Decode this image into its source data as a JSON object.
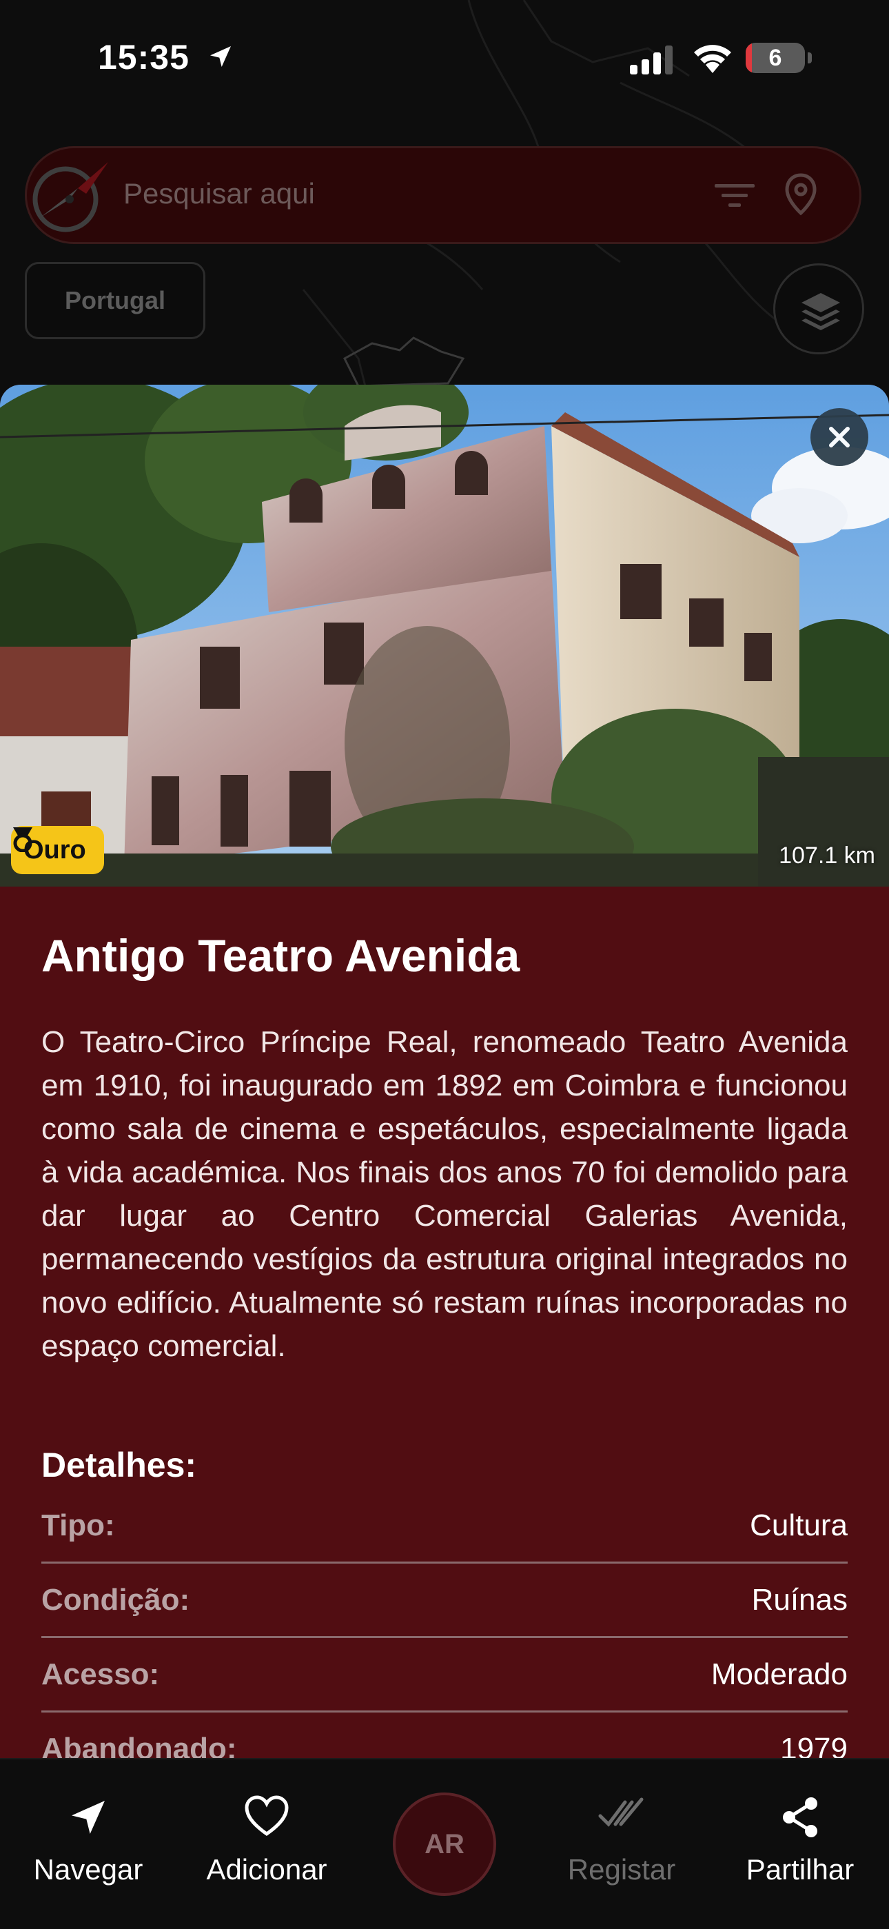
{
  "status_bar": {
    "time": "15:35",
    "battery_level": "6",
    "location_icon": "location-arrow-icon",
    "signal_icon": "cellular-signal-icon",
    "wifi_icon": "wifi-icon"
  },
  "search": {
    "placeholder": "Pesquisar aqui",
    "filter_icon": "filter-icon",
    "location_icon": "map-pin-icon"
  },
  "map": {
    "region_chip": "Portugal",
    "layers_icon": "layers-icon"
  },
  "place": {
    "tier": "Ouro",
    "tier_color": "#f5c518",
    "distance": "107.1 km",
    "title": "Antigo Teatro Avenida",
    "description": "O Teatro-Circo Príncipe Real, renomeado Teatro Avenida em 1910, foi inaugurado em 1892 em Coimbra e funcionou como sala de cinema e espetáculos, especialmente ligada à vida académica. Nos finais dos anos 70 foi demolido para dar lugar ao Centro Comercial Galerias Avenida, permanecendo vestígios da estrutura original integrados no novo edifício. Atualmente só restam ruínas incorporadas no espaço comercial.",
    "details_heading": "Detalhes:",
    "details": [
      {
        "label": "Tipo:",
        "value": "Cultura"
      },
      {
        "label": "Condição:",
        "value": "Ruínas"
      },
      {
        "label": "Acesso:",
        "value": "Moderado"
      },
      {
        "label": "Abandonado:",
        "value": "1979"
      }
    ]
  },
  "bottom_nav": {
    "navigate": "Navegar",
    "add": "Adicionar",
    "ar": "AR",
    "register": "Registar",
    "share": "Partilhar"
  },
  "colors": {
    "sheet_background": "#510d12",
    "search_background": "#2b0607",
    "close_button": "#2d3f4c"
  }
}
